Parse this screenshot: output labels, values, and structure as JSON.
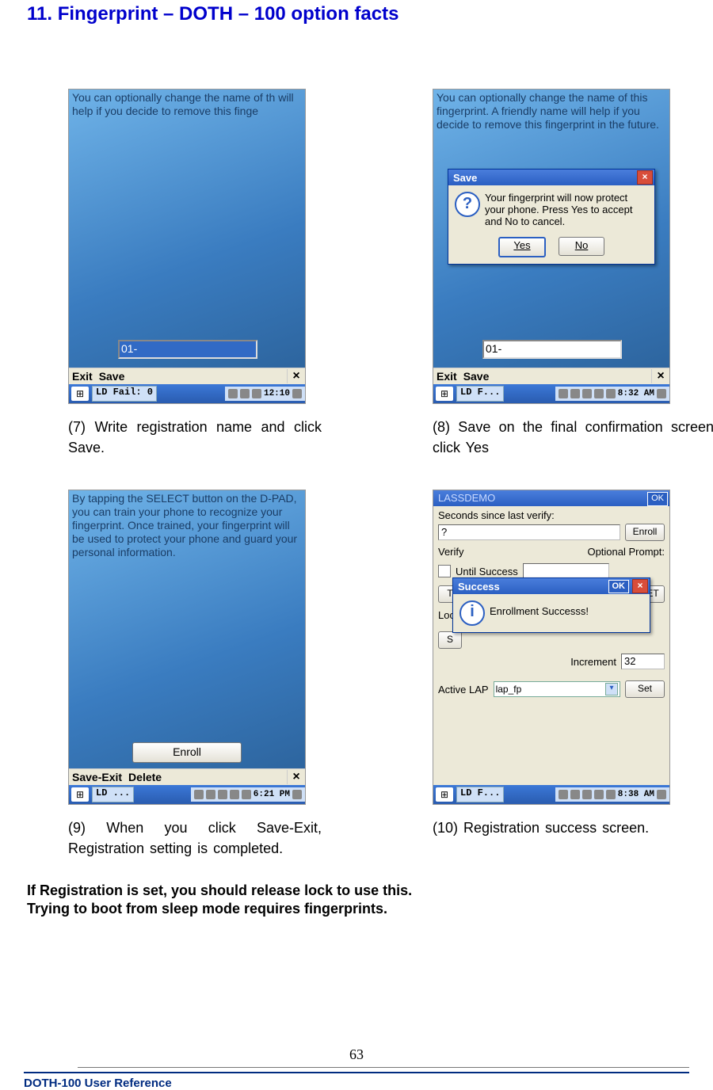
{
  "title": "11. Fingerprint – DOTH – 100 option facts",
  "shots": {
    "s7": {
      "topText": "You can optionally change the name of th will help if you decide to remove this finge",
      "inputValue": "01-",
      "menubar": [
        "Exit",
        "Save"
      ],
      "taskLabel": "LD Fail: 0",
      "clock": "12:10"
    },
    "s8": {
      "topText": "You can optionally change the name of this fingerprint. A friendly name will help if you decide to remove this fingerprint in the future.",
      "inputValue": "01-",
      "menubar": [
        "Exit",
        "Save"
      ],
      "taskLabel": "LD F...",
      "clock": "8:32 AM",
      "dialog": {
        "title": "Save",
        "body": "Your fingerprint will now protect your phone. Press Yes to accept and No to cancel.",
        "yes": "Yes",
        "no": "No"
      }
    },
    "s9": {
      "topText": "By tapping the SELECT button on the D-PAD, you can train your phone to recognize your fingerprint. Once trained, your fingerprint will be used to protect your phone and guard your personal information.",
      "enroll": "Enroll",
      "menubar": [
        "Save-Exit",
        "Delete"
      ],
      "taskLabel": "LD ...",
      "clock": "6:21 PM"
    },
    "s10": {
      "hdr": "LASSDEMO",
      "ok": "OK",
      "secondsLabel": "Seconds since last verify:",
      "secondsVal": "?",
      "enroll": "Enroll",
      "verify": "Verify",
      "optPrompt": "Optional Prompt:",
      "untilSuccess": "Until Success",
      "tl": "T",
      "et": "ET",
      "lock": "Lock",
      "s_": "S",
      "increment": "Increment",
      "incVal": "32",
      "activeLap": "Active LAP",
      "lapVal": "lap_fp",
      "set": "Set",
      "dialog": {
        "title": "Success",
        "ok": "OK",
        "body": "Enrollment Successs!"
      },
      "taskLabel": "LD F...",
      "clock": "8:38 AM"
    }
  },
  "captions": {
    "c7": "(7) Write registration name and click Save.",
    "c8": "(8) Save on the final confirmation screen, click Yes",
    "c9": "(9) When you click Save-Exit, Registration setting is completed.",
    "c10": "(10) Registration success screen."
  },
  "notes": {
    "n1": "If Registration is set, you should release lock to use this.",
    "n2": "Trying to boot from sleep mode requires fingerprints."
  },
  "pageNumber": "63",
  "footer": "DOTH-100 User Reference"
}
